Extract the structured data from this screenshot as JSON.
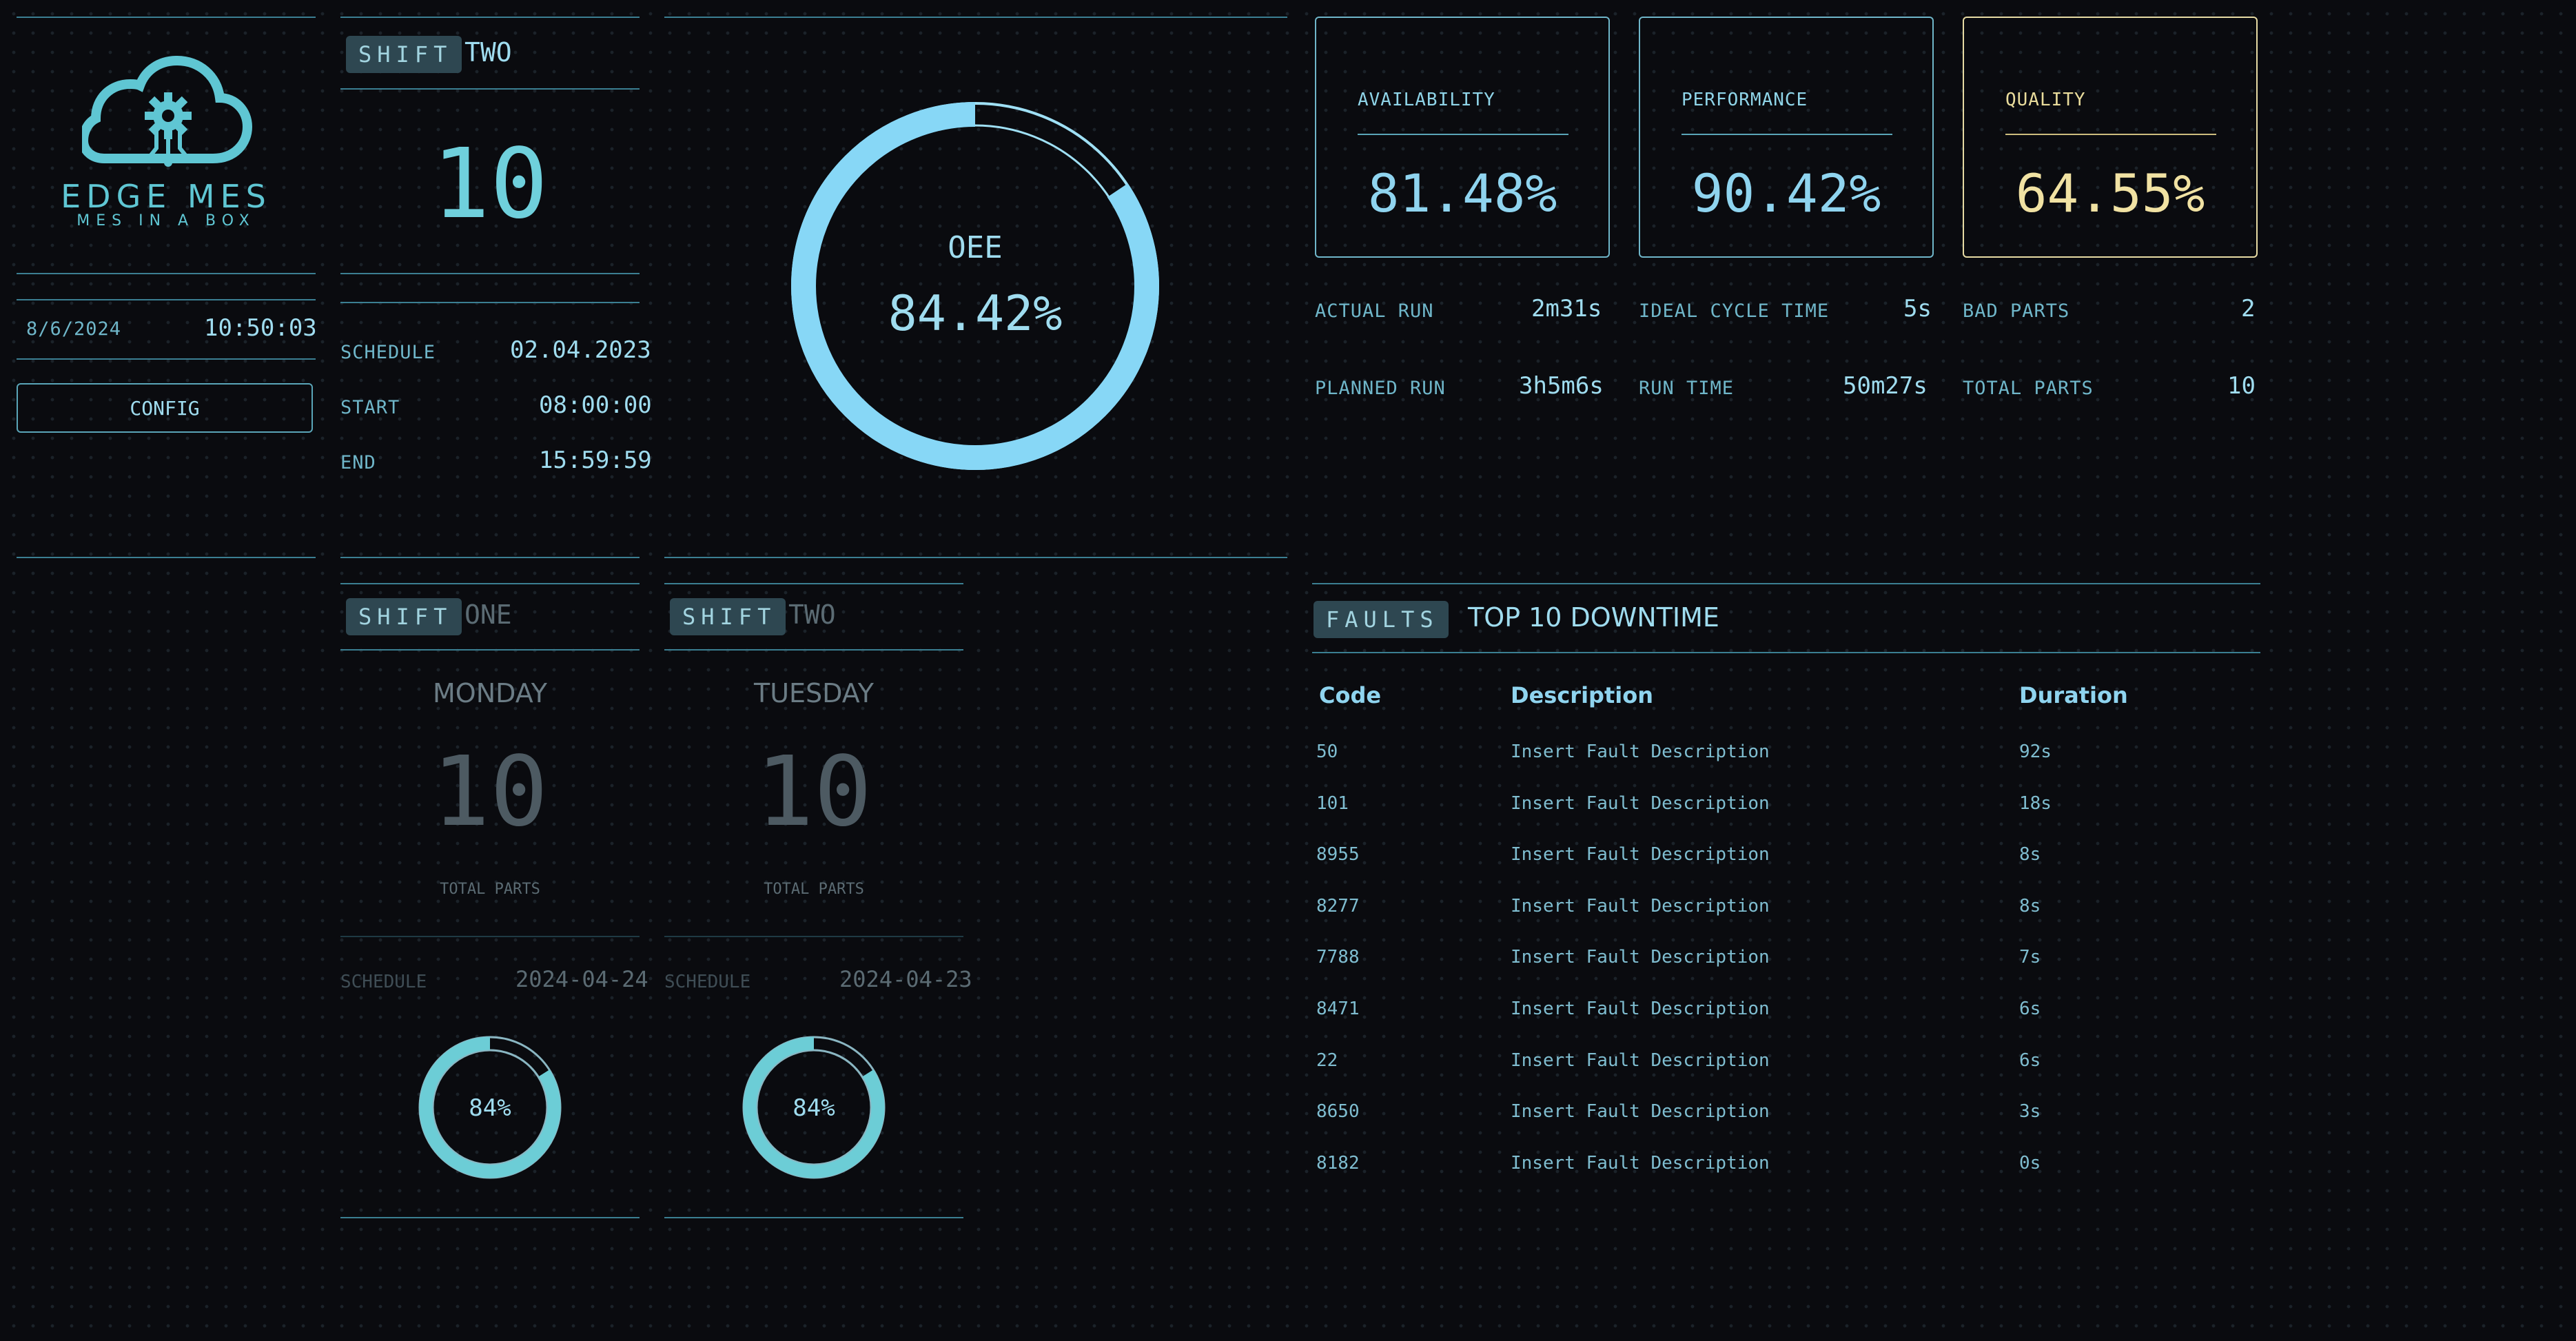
{
  "brand": {
    "name": "EDGE MES",
    "tagline": "MES IN A BOX"
  },
  "clock": {
    "date": "8/6/2024",
    "time": "10:50:03"
  },
  "config_button": "CONFIG",
  "current_shift": {
    "badge": "SHIFT",
    "name": "TWO",
    "count": "10",
    "schedule_label": "SCHEDULE",
    "schedule": "02.04.2023",
    "start_label": "START",
    "start": "08:00:00",
    "end_label": "END",
    "end": "15:59:59"
  },
  "oee": {
    "label": "OEE",
    "value": "84.42%",
    "fraction": 0.8442
  },
  "metrics": {
    "availability": {
      "label": "AVAILABILITY",
      "value": "81.48%"
    },
    "performance": {
      "label": "PERFORMANCE",
      "value": "90.42%"
    },
    "quality": {
      "label": "QUALITY",
      "value": "64.55%"
    }
  },
  "stats": {
    "actual_run_label": "ACTUAL RUN",
    "actual_run": "2m31s",
    "planned_run_label": "PLANNED RUN",
    "planned_run": "3h5m6s",
    "ideal_cycle_label": "IDEAL CYCLE TIME",
    "ideal_cycle": "5s",
    "run_time_label": "RUN TIME",
    "run_time": "50m27s",
    "bad_parts_label": "BAD PARTS",
    "bad_parts": "2",
    "total_parts_label": "TOTAL PARTS",
    "total_parts": "10"
  },
  "history": [
    {
      "badge": "SHIFT",
      "name": "ONE",
      "day": "MONDAY",
      "count": "10",
      "count_label": "TOTAL PARTS",
      "schedule_label": "SCHEDULE",
      "schedule": "2024-04-24",
      "oee_text": "84%",
      "oee_fraction": 0.84
    },
    {
      "badge": "SHIFT",
      "name": "TWO",
      "day": "TUESDAY",
      "count": "10",
      "count_label": "TOTAL PARTS",
      "schedule_label": "SCHEDULE",
      "schedule": "2024-04-23",
      "oee_text": "84%",
      "oee_fraction": 0.84
    }
  ],
  "faults": {
    "badge": "FAULTS",
    "title": "TOP 10 DOWNTIME",
    "columns": [
      "Code",
      "Description",
      "Duration"
    ],
    "rows": [
      {
        "code": "50",
        "desc": "Insert Fault Description",
        "dur": "92s"
      },
      {
        "code": "101",
        "desc": "Insert Fault Description",
        "dur": "18s"
      },
      {
        "code": "8955",
        "desc": "Insert Fault Description",
        "dur": "8s"
      },
      {
        "code": "8277",
        "desc": "Insert Fault Description",
        "dur": "8s"
      },
      {
        "code": "7788",
        "desc": "Insert Fault Description",
        "dur": "7s"
      },
      {
        "code": "8471",
        "desc": "Insert Fault Description",
        "dur": "6s"
      },
      {
        "code": "22",
        "desc": "Insert Fault Description",
        "dur": "6s"
      },
      {
        "code": "8650",
        "desc": "Insert Fault Description",
        "dur": "3s"
      },
      {
        "code": "8182",
        "desc": "Insert Fault Description",
        "dur": "0s"
      }
    ]
  }
}
